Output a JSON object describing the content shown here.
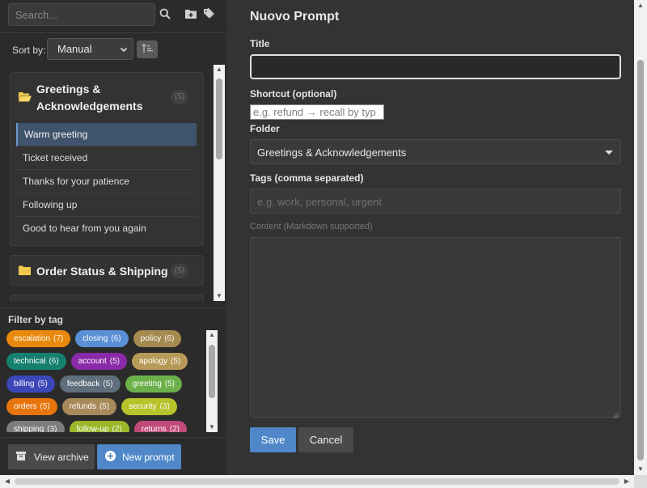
{
  "sidebar": {
    "search_placeholder": "Search...",
    "icons": [
      "search-icon",
      "folder-plus-icon",
      "tag-icon"
    ],
    "sort_label": "Sort by:",
    "sort_value": "Manual",
    "folders": [
      {
        "name": "Greetings & Acknowledgements",
        "count": "(5)",
        "expanded": true,
        "prompts": [
          {
            "label": "Warm greeting",
            "active": true
          },
          {
            "label": "Ticket received",
            "active": false
          },
          {
            "label": "Thanks for your patience",
            "active": false
          },
          {
            "label": "Following up",
            "active": false
          },
          {
            "label": "Good to hear from you again",
            "active": false
          }
        ]
      },
      {
        "name": "Order Status & Shipping",
        "count": "(5)",
        "expanded": false,
        "prompts": []
      }
    ],
    "filter_title": "Filter by tag",
    "tags": [
      [
        {
          "name": "escalation",
          "count": "(7)",
          "color": "#e8890c"
        },
        {
          "name": "closing",
          "count": "(6)",
          "color": "#5a8fd6"
        },
        {
          "name": "policy",
          "count": "(6)",
          "color": "#a58a4f"
        }
      ],
      [
        {
          "name": "technical",
          "count": "(6)",
          "color": "#16806e"
        },
        {
          "name": "account",
          "count": "(5)",
          "color": "#8a2aa8"
        },
        {
          "name": "apology",
          "count": "(5)",
          "color": "#b89a58"
        }
      ],
      [
        {
          "name": "billing",
          "count": "(5)",
          "color": "#3b47b8"
        },
        {
          "name": "feedback",
          "count": "(5)",
          "color": "#5e6e7c"
        },
        {
          "name": "greeting",
          "count": "(5)",
          "color": "#6bb04a"
        }
      ],
      [
        {
          "name": "orders",
          "count": "(5)",
          "color": "#e8740c"
        },
        {
          "name": "refunds",
          "count": "(5)",
          "color": "#a88a5a"
        },
        {
          "name": "security",
          "count": "(3)",
          "color": "#b8c22a"
        }
      ],
      [
        {
          "name": "shipping",
          "count": "(3)",
          "color": "#7c7c7c"
        },
        {
          "name": "follow-up",
          "count": "(2)",
          "color": "#9ab82a"
        },
        {
          "name": "returns",
          "count": "(2)",
          "color": "#c04a7a"
        }
      ]
    ],
    "view_archive_label": "View archive",
    "new_prompt_label": "New prompt"
  },
  "form": {
    "title": "Nuovo Prompt",
    "title_label": "Title",
    "title_value": "",
    "shortcut_label": "Shortcut (optional)",
    "shortcut_placeholder": "e.g. refund  →  recall by typ",
    "folder_label": "Folder",
    "folder_value": "Greetings & Acknowledgements",
    "tags_label": "Tags (comma separated)",
    "tags_placeholder": "e.g. work, personal, urgent",
    "content_label": "Content (Markdown supported)",
    "save_label": "Save",
    "cancel_label": "Cancel"
  },
  "colors": {
    "accent": "#4f87c9",
    "panel_bg": "#333333",
    "sidebar_bg": "#2b2b2b",
    "active_item": "#40536c"
  }
}
